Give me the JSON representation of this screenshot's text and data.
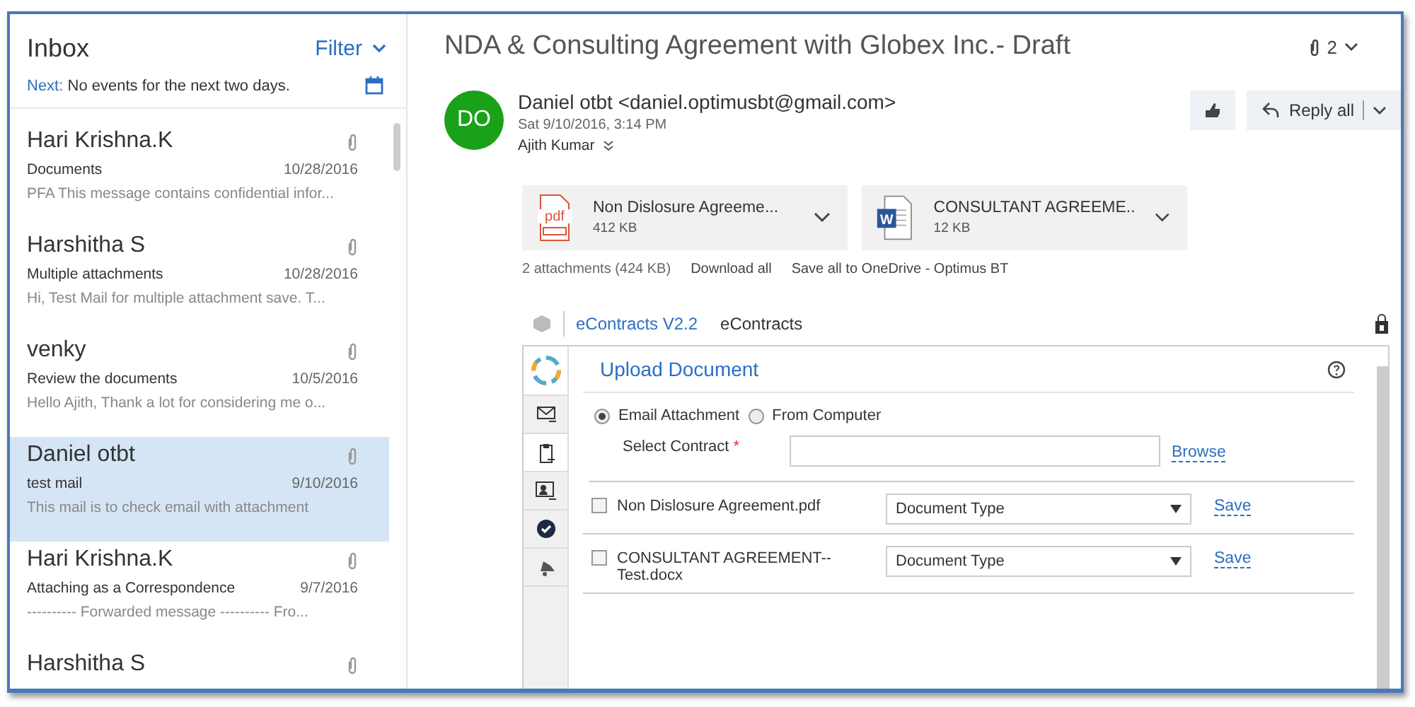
{
  "inbox": {
    "title": "Inbox",
    "filter": "Filter",
    "next_label": "Next:",
    "next_text": "No events for the next two days."
  },
  "messages": [
    {
      "sender": "Hari Krishna.K",
      "subject": "Documents",
      "date": "10/28/2016",
      "preview": "PFA  This message contains confidential infor...",
      "selected": false
    },
    {
      "sender": "Harshitha S",
      "subject": "Multiple attachments",
      "date": "10/28/2016",
      "preview": "Hi,  Test Mail for multiple attachment save.  T...",
      "selected": false
    },
    {
      "sender": "venky",
      "subject": "Review the documents",
      "date": "10/5/2016",
      "preview": "Hello Ajith,  Thank a lot for considering me o...",
      "selected": false
    },
    {
      "sender": "Daniel otbt",
      "subject": "test mail",
      "date": "9/10/2016",
      "preview": "This mail is to check email with attachment",
      "selected": true
    },
    {
      "sender": "Hari Krishna.K",
      "subject": "Attaching as a Correspondence",
      "date": "9/7/2016",
      "preview": "---------- Forwarded message ---------- Fro...",
      "selected": false
    },
    {
      "sender": "Harshitha S",
      "selected": false
    }
  ],
  "email": {
    "subject": "NDA & Consulting Agreement with Globex Inc.- Draft",
    "attach_count": "2",
    "avatar": "DO",
    "from": "Daniel otbt <daniel.optimusbt@gmail.com>",
    "sent": "Sat 9/10/2016, 3:14 PM",
    "to": "Ajith Kumar",
    "reply": "Reply all",
    "attachments": [
      {
        "kind": "pdf",
        "icon_text": "pdf",
        "name": "Non Dislosure Agreeme...",
        "size": "412 KB"
      },
      {
        "kind": "word",
        "icon_text": "W",
        "name": "CONSULTANT AGREEME..",
        "size": "12 KB"
      }
    ],
    "summary": "2 attachments (424 KB)",
    "download_all": "Download all",
    "save_all": "Save all to OneDrive - Optimus BT"
  },
  "addin": {
    "name": "eContracts V2.2",
    "provider": "eContracts",
    "nav": [
      {
        "kind": "logo",
        "selected": true
      },
      {
        "kind": "mail",
        "selected": false
      },
      {
        "kind": "clipboard",
        "selected": true
      },
      {
        "kind": "contact",
        "selected": false
      },
      {
        "kind": "check",
        "selected": false
      },
      {
        "kind": "bell",
        "selected": false
      }
    ],
    "heading": "Upload Document",
    "sources": [
      {
        "label": "Email Attachment",
        "selected": true
      },
      {
        "label": "From Computer",
        "selected": false
      }
    ],
    "contract_label": "Select Contract",
    "required_mark": "*",
    "browse": "Browse",
    "files": [
      {
        "name": "Non Dislosure Agreement.pdf",
        "checked": false,
        "type": "Document Type",
        "save": "Save"
      },
      {
        "name": "CONSULTANT AGREEMENT--Test.docx",
        "checked": false,
        "type": "Document Type",
        "save": "Save"
      }
    ]
  }
}
